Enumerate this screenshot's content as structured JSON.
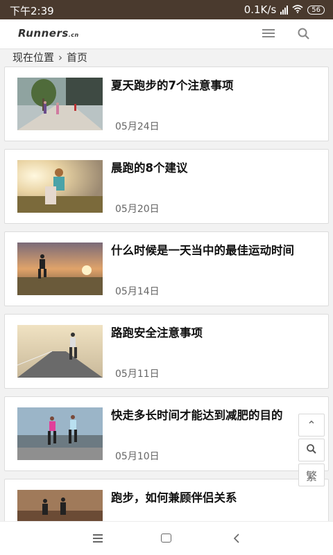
{
  "status_bar": {
    "time": "下午2:39",
    "net_speed": "0.1K/s",
    "battery": "56"
  },
  "header": {
    "logo_main": "Runners",
    "logo_suffix": ".cn"
  },
  "breadcrumb": {
    "label": "现在位置",
    "separator": "›",
    "current": "首页"
  },
  "articles": [
    {
      "title": "夏天跑步的7个注意事项",
      "date": "05月24日"
    },
    {
      "title": "晨跑的8个建议",
      "date": "05月20日"
    },
    {
      "title": "什么时候是一天当中的最佳运动时间",
      "date": "05月14日"
    },
    {
      "title": "路跑安全注意事项",
      "date": "05月11日"
    },
    {
      "title": "快走多长时间才能达到减肥的目的",
      "date": "05月10日"
    },
    {
      "title": "跑步，如何兼顾伴侣关系",
      "date": ""
    }
  ],
  "float_buttons": {
    "top": "⌃",
    "traditional": "繁"
  },
  "colors": {
    "status_bar": "#4a3a2e",
    "background": "#f2f2f2"
  }
}
